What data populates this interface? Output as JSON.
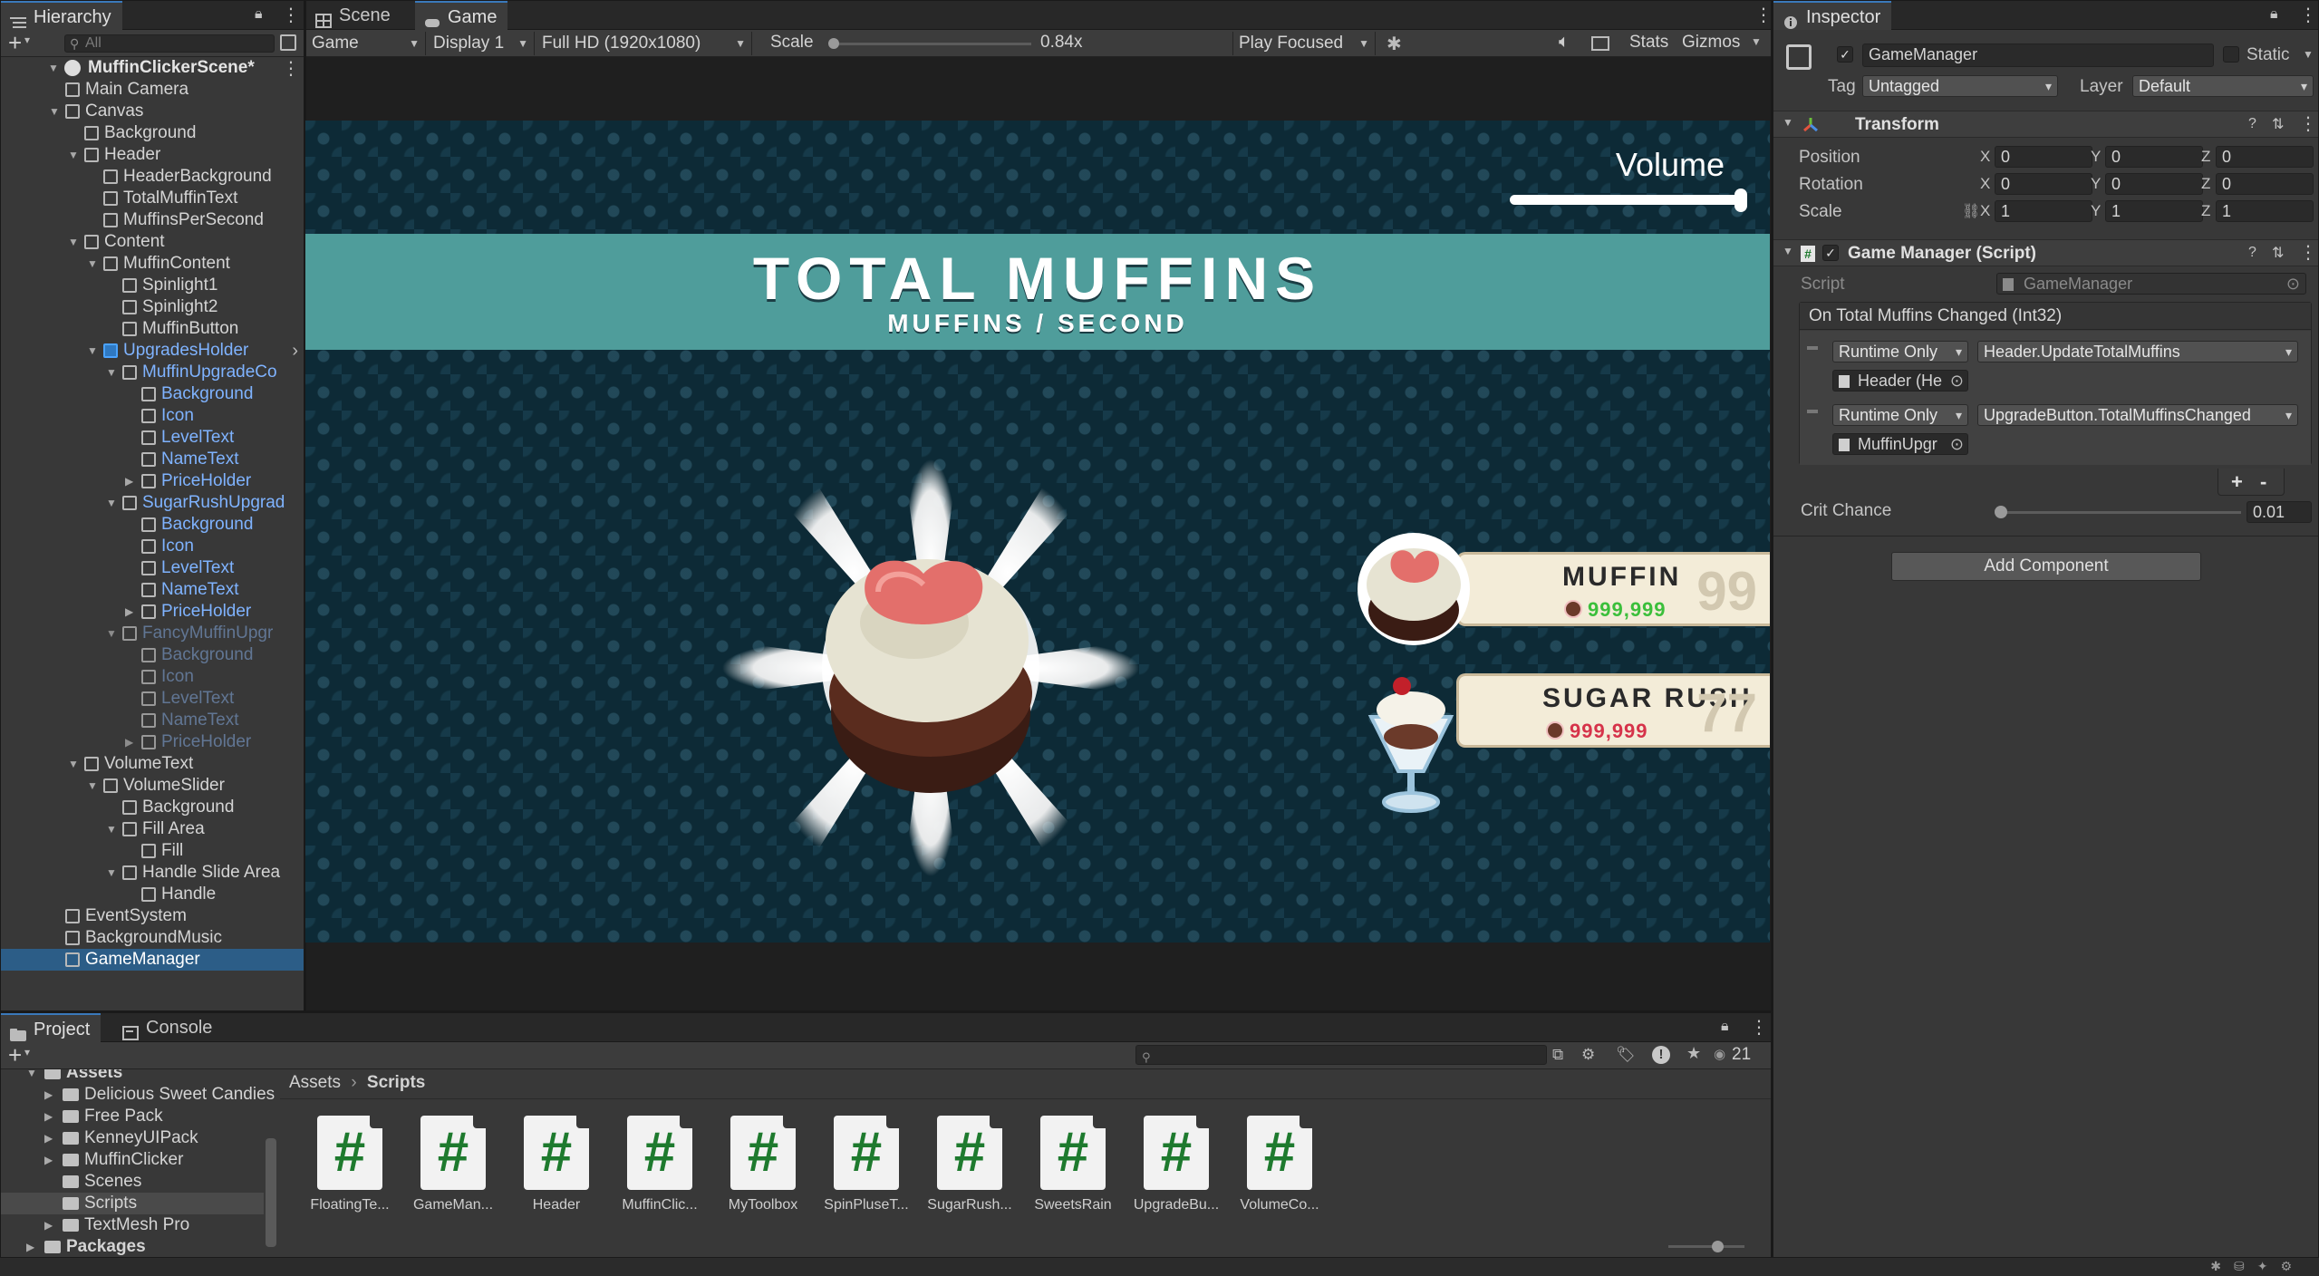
{
  "hierarchy": {
    "tab": "Hierarchy",
    "search_placeholder": "All",
    "scene": "MuffinClickerScene*",
    "items": [
      {
        "label": "Main Camera"
      },
      {
        "label": "Canvas"
      },
      {
        "label": "Background"
      },
      {
        "label": "Header"
      },
      {
        "label": "HeaderBackground"
      },
      {
        "label": "TotalMuffinText"
      },
      {
        "label": "MuffinsPerSecond"
      },
      {
        "label": "Content"
      },
      {
        "label": "MuffinContent"
      },
      {
        "label": "Spinlight1"
      },
      {
        "label": "Spinlight2"
      },
      {
        "label": "MuffinButton"
      },
      {
        "label": "UpgradesHolder"
      },
      {
        "label": "MuffinUpgradeCo"
      },
      {
        "label": "Background"
      },
      {
        "label": "Icon"
      },
      {
        "label": "LevelText"
      },
      {
        "label": "NameText"
      },
      {
        "label": "PriceHolder"
      },
      {
        "label": "SugarRushUpgrad"
      },
      {
        "label": "Background"
      },
      {
        "label": "Icon"
      },
      {
        "label": "LevelText"
      },
      {
        "label": "NameText"
      },
      {
        "label": "PriceHolder"
      },
      {
        "label": "FancyMuffinUpgr"
      },
      {
        "label": "Background"
      },
      {
        "label": "Icon"
      },
      {
        "label": "LevelText"
      },
      {
        "label": "NameText"
      },
      {
        "label": "PriceHolder"
      },
      {
        "label": "VolumeText"
      },
      {
        "label": "VolumeSlider"
      },
      {
        "label": "Background"
      },
      {
        "label": "Fill Area"
      },
      {
        "label": "Fill"
      },
      {
        "label": "Handle Slide Area"
      },
      {
        "label": "Handle"
      },
      {
        "label": "EventSystem"
      },
      {
        "label": "BackgroundMusic"
      },
      {
        "label": "GameManager"
      }
    ]
  },
  "game_view": {
    "tabs": [
      "Scene",
      "Game"
    ],
    "mode": "Game",
    "display": "Display 1",
    "resolution": "Full HD (1920x1080)",
    "scale_label": "Scale",
    "scale_value": "0.84x",
    "play_mode": "Play Focused",
    "stats": "Stats",
    "gizmos": "Gizmos"
  },
  "game": {
    "volume_label": "Volume",
    "volume_level": 1.0,
    "title": "TOTAL MUFFINS",
    "subtitle": "MUFFINS / SECOND",
    "upgrades": [
      {
        "name": "MUFFIN",
        "price": "999,999",
        "level": "99",
        "price_color": "#3bbf3b"
      },
      {
        "name": "SUGAR RUSH",
        "price": "999,999",
        "level": "77",
        "price_color": "#d6334a"
      }
    ]
  },
  "inspector": {
    "tab": "Inspector",
    "object_name": "GameManager",
    "static_label": "Static",
    "tag_label": "Tag",
    "tag_value": "Untagged",
    "layer_label": "Layer",
    "layer_value": "Default",
    "transform": {
      "title": "Transform",
      "position_label": "Position",
      "rotation_label": "Rotation",
      "scale_label": "Scale",
      "position": [
        "0",
        "0",
        "0"
      ],
      "rotation": [
        "0",
        "0",
        "0"
      ],
      "scale": [
        "1",
        "1",
        "1"
      ],
      "axes": [
        "X",
        "Y",
        "Z"
      ]
    },
    "script_component": {
      "title": "Game Manager (Script)",
      "script_label": "Script",
      "script_value": "GameManager",
      "event_title": "On Total Muffins Changed (Int32)",
      "listeners": [
        {
          "mode": "Runtime Only",
          "function": "Header.UpdateTotalMuffins",
          "target": "Header (He"
        },
        {
          "mode": "Runtime Only",
          "function": "UpgradeButton.TotalMuffinsChanged",
          "target": "MuffinUpgr"
        }
      ],
      "plus": "+",
      "minus": "-",
      "crit_label": "Crit Chance",
      "crit_value": "0.01"
    },
    "add_component": "Add Component"
  },
  "project": {
    "tabs": [
      "Project",
      "Console"
    ],
    "folders": [
      {
        "label": "Assets"
      },
      {
        "label": "Delicious Sweet Candies"
      },
      {
        "label": "Free Pack"
      },
      {
        "label": "KenneyUIPack"
      },
      {
        "label": "MuffinClicker"
      },
      {
        "label": "Scenes"
      },
      {
        "label": "Scripts"
      },
      {
        "label": "TextMesh Pro"
      },
      {
        "label": "Packages"
      }
    ],
    "breadcrumb": [
      "Assets",
      "Scripts"
    ],
    "count": "21",
    "assets": [
      {
        "name": "FloatingTe..."
      },
      {
        "name": "GameMan..."
      },
      {
        "name": "Header"
      },
      {
        "name": "MuffinClic..."
      },
      {
        "name": "MyToolbox"
      },
      {
        "name": "SpinPluseT..."
      },
      {
        "name": "SugarRush..."
      },
      {
        "name": "SweetsRain"
      },
      {
        "name": "UpgradeBu..."
      },
      {
        "name": "VolumeCo..."
      }
    ]
  }
}
